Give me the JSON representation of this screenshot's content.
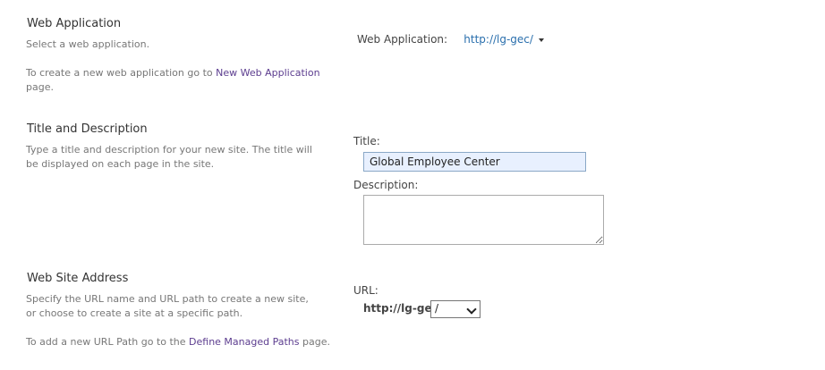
{
  "web_application": {
    "title": "Web Application",
    "desc_line1": "Select a web application.",
    "create_text_before": "To create a new web application go to ",
    "create_link": "New Web Application",
    "create_text_after": "page.",
    "selector_label": "Web Application:",
    "selector_value": "http://lg-gec/"
  },
  "title_description": {
    "title": "Title and Description",
    "desc": "Type a title and description for your new site. The title will be displayed on each page in the site.",
    "title_label": "Title:",
    "title_value": "Global Employee Center",
    "description_label": "Description:",
    "description_value": ""
  },
  "web_site_address": {
    "title": "Web Site Address",
    "desc": "Specify the URL name and URL path to create a new site, or choose to create a site at a specific path.",
    "managed_text_before": "To add a new URL Path go to the ",
    "managed_link": "Define Managed Paths",
    "managed_text_after": " page.",
    "url_label": "URL:",
    "url_prefix": "http://lg-gec",
    "url_path_selected": "/"
  },
  "colors": {
    "link": "#5c3d8f",
    "webapp_value": "#2a6fad",
    "title_input_bg": "#e8f0fe"
  },
  "icons": {
    "webapp_dropdown": "caret-down-icon",
    "url_select_dropdown": "chevron-down-icon"
  }
}
